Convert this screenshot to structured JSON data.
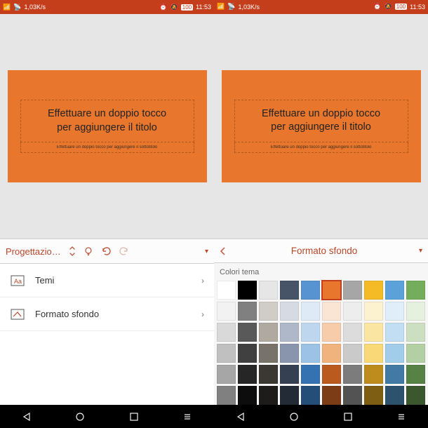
{
  "status": {
    "speed": "1,03K/s",
    "battery": "100",
    "time": "11:53"
  },
  "slide": {
    "title_line1": "Effettuare un doppio tocco",
    "title_line2": "per aggiungere il titolo",
    "subtitle": "Effettuare un doppio tocco per aggiungere il sottotitolo"
  },
  "toolbar_left": {
    "tab": "Progettazio…"
  },
  "toolbar_right": {
    "title": "Formato sfondo"
  },
  "menu": {
    "item1": "Temi",
    "item2": "Formato sfondo"
  },
  "palette": {
    "label": "Colori tema",
    "row1": [
      "#ffffff",
      "#000000",
      "#e6e6e6",
      "#475468",
      "#5793d0",
      "#e8762c",
      "#a6a6a6",
      "#f4bb27",
      "#5aa2d9",
      "#74ad5c"
    ],
    "row2": [
      "#f2f2f2",
      "#808080",
      "#d0cdc7",
      "#d6dbe3",
      "#deeaf6",
      "#fae5d5",
      "#ededed",
      "#fdf2d0",
      "#dfeef8",
      "#e5f0df"
    ],
    "row3": [
      "#d9d9d9",
      "#595959",
      "#afa9a0",
      "#aeb8c8",
      "#bed7ee",
      "#f6ccab",
      "#dcdcdc",
      "#fbe5a3",
      "#c1def2",
      "#ccdfc1"
    ],
    "row4": [
      "#c0c0c0",
      "#404040",
      "#77726a",
      "#8895ad",
      "#9cc3e5",
      "#f1b37d",
      "#cacaca",
      "#f9d977",
      "#a2cdea",
      "#b3d0a5"
    ],
    "row5": [
      "#a6a6a6",
      "#262626",
      "#3b3834",
      "#354053",
      "#3572b1",
      "#ba5a1f",
      "#7c7c7c",
      "#bd8c1c",
      "#417aa4",
      "#578245"
    ],
    "row6": [
      "#808080",
      "#0d0d0d",
      "#1e1c1a",
      "#232b37",
      "#244d77",
      "#7c3c15",
      "#535353",
      "#7e5e13",
      "#2c526d",
      "#3a572e"
    ]
  },
  "colors": {
    "accent": "#b7472a",
    "slide_bg": "#e8762c",
    "status_bg": "#c43e1c"
  }
}
